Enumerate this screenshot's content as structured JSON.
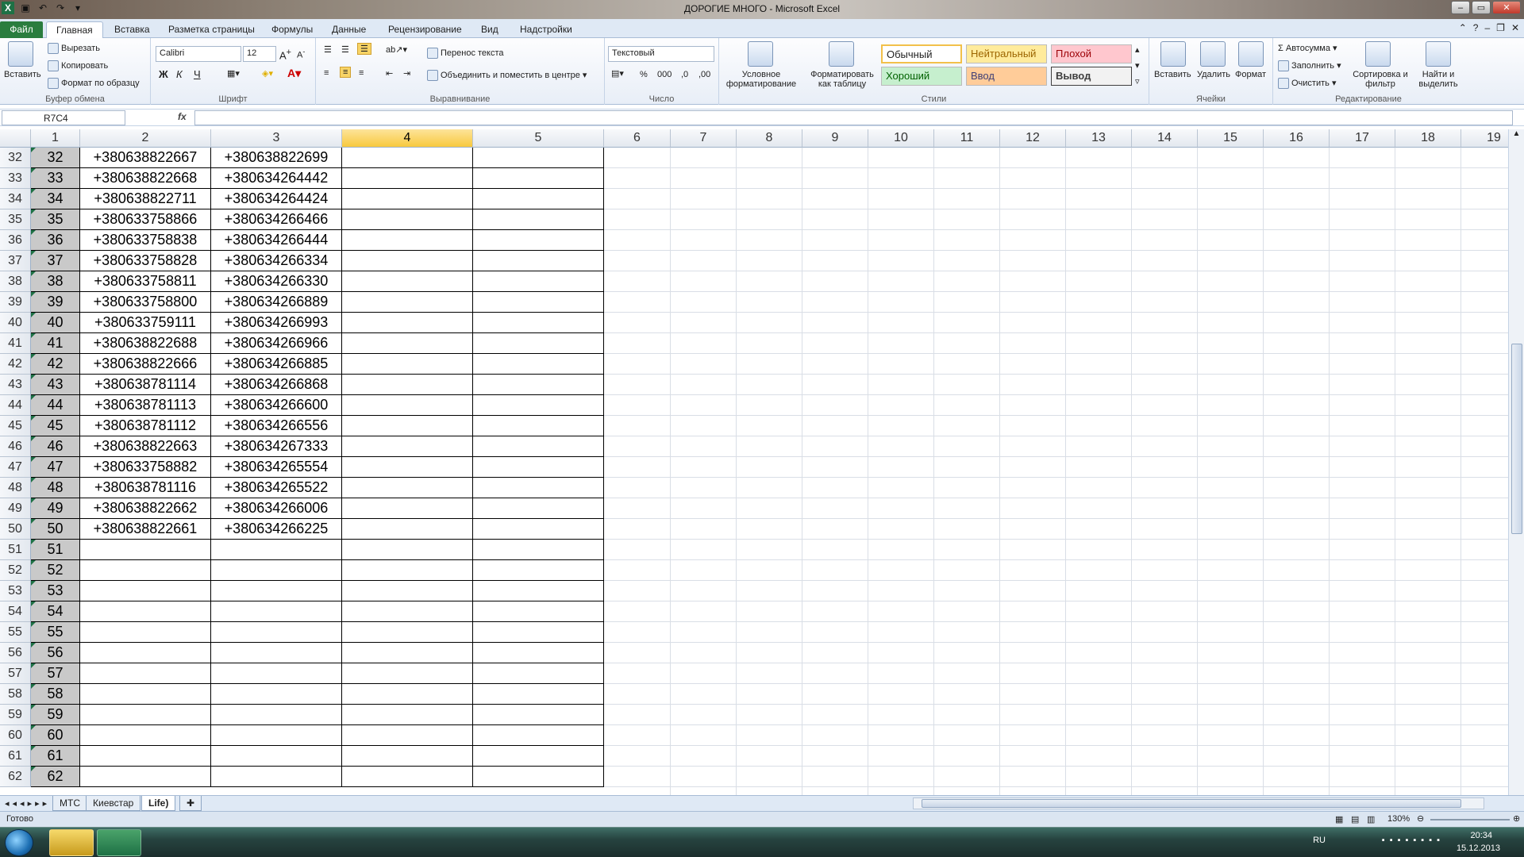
{
  "window": {
    "title": "ДОРОГИЕ МНОГО  -  Microsoft Excel"
  },
  "ribbon_tabs": [
    "Файл",
    "Главная",
    "Вставка",
    "Разметка страницы",
    "Формулы",
    "Данные",
    "Рецензирование",
    "Вид",
    "Надстройки"
  ],
  "clipboard": {
    "paste": "Вставить",
    "cut": "Вырезать",
    "copy": "Копировать",
    "format_painter": "Формат по образцу",
    "label": "Буфер обмена"
  },
  "font": {
    "name": "Calibri",
    "size": "12",
    "bold": "Ж",
    "italic": "К",
    "underline": "Ч",
    "label": "Шрифт"
  },
  "alignment": {
    "wrap": "Перенос текста",
    "merge": "Объединить и поместить в центре",
    "label": "Выравнивание"
  },
  "number": {
    "format": "Текстовый",
    "percent": "%",
    "thousands": "000",
    "label": "Число"
  },
  "styles": {
    "conditional": "Условное форматирование",
    "as_table": "Форматировать как таблицу",
    "normal": "Обычный",
    "neutral": "Нейтральный",
    "bad": "Плохой",
    "good": "Хороший",
    "input": "Ввод",
    "output": "Вывод",
    "label": "Стили"
  },
  "cells_group": {
    "insert": "Вставить",
    "delete": "Удалить",
    "format": "Формат",
    "label": "Ячейки"
  },
  "editing": {
    "autosum": "Автосумма",
    "fill": "Заполнить",
    "clear": "Очистить",
    "sort": "Сортировка и фильтр",
    "find": "Найти и выделить",
    "label": "Редактирование"
  },
  "formula_bar": {
    "name_box": "R7C4",
    "fx": "fx",
    "value": ""
  },
  "columns": [
    "1",
    "2",
    "3",
    "4",
    "5",
    "6",
    "7",
    "8",
    "9",
    "10",
    "11",
    "12",
    "13",
    "14",
    "15",
    "16",
    "17",
    "18",
    "19"
  ],
  "selected_column": "4",
  "rows": [
    {
      "n": "32",
      "a": "32",
      "b": "+380638822667",
      "c": "+380638822699"
    },
    {
      "n": "33",
      "a": "33",
      "b": "+380638822668",
      "c": "+380634264442"
    },
    {
      "n": "34",
      "a": "34",
      "b": "+380638822711",
      "c": "+380634264424"
    },
    {
      "n": "35",
      "a": "35",
      "b": "+380633758866",
      "c": "+380634266466"
    },
    {
      "n": "36",
      "a": "36",
      "b": "+380633758838",
      "c": "+380634266444"
    },
    {
      "n": "37",
      "a": "37",
      "b": "+380633758828",
      "c": "+380634266334"
    },
    {
      "n": "38",
      "a": "38",
      "b": "+380633758811",
      "c": "+380634266330"
    },
    {
      "n": "39",
      "a": "39",
      "b": "+380633758800",
      "c": "+380634266889"
    },
    {
      "n": "40",
      "a": "40",
      "b": "+380633759111",
      "c": "+380634266993"
    },
    {
      "n": "41",
      "a": "41",
      "b": "+380638822688",
      "c": "+380634266966"
    },
    {
      "n": "42",
      "a": "42",
      "b": "+380638822666",
      "c": "+380634266885"
    },
    {
      "n": "43",
      "a": "43",
      "b": "+380638781114",
      "c": "+380634266868"
    },
    {
      "n": "44",
      "a": "44",
      "b": "+380638781113",
      "c": "+380634266600"
    },
    {
      "n": "45",
      "a": "45",
      "b": "+380638781112",
      "c": "+380634266556"
    },
    {
      "n": "46",
      "a": "46",
      "b": "+380638822663",
      "c": "+380634267333"
    },
    {
      "n": "47",
      "a": "47",
      "b": "+380633758882",
      "c": "+380634265554"
    },
    {
      "n": "48",
      "a": "48",
      "b": "+380638781116",
      "c": "+380634265522"
    },
    {
      "n": "49",
      "a": "49",
      "b": "+380638822662",
      "c": "+380634266006"
    },
    {
      "n": "50",
      "a": "50",
      "b": "+380638822661",
      "c": "+380634266225"
    },
    {
      "n": "51",
      "a": "51",
      "b": "",
      "c": ""
    },
    {
      "n": "52",
      "a": "52",
      "b": "",
      "c": ""
    },
    {
      "n": "53",
      "a": "53",
      "b": "",
      "c": ""
    },
    {
      "n": "54",
      "a": "54",
      "b": "",
      "c": ""
    },
    {
      "n": "55",
      "a": "55",
      "b": "",
      "c": ""
    },
    {
      "n": "56",
      "a": "56",
      "b": "",
      "c": ""
    },
    {
      "n": "57",
      "a": "57",
      "b": "",
      "c": ""
    },
    {
      "n": "58",
      "a": "58",
      "b": "",
      "c": ""
    },
    {
      "n": "59",
      "a": "59",
      "b": "",
      "c": ""
    },
    {
      "n": "60",
      "a": "60",
      "b": "",
      "c": ""
    },
    {
      "n": "61",
      "a": "61",
      "b": "",
      "c": ""
    },
    {
      "n": "62",
      "a": "62",
      "b": "",
      "c": ""
    }
  ],
  "sheets": [
    "МТС",
    "Киевстар",
    "Life)"
  ],
  "active_sheet": "Life)",
  "status": {
    "ready": "Готово",
    "zoom": "130%"
  },
  "tray": {
    "lang": "RU",
    "time": "20:34",
    "date": "15.12.2013"
  },
  "colors": {
    "file_tab": "#2a7d3e",
    "selected_header": "#f8c93e",
    "excel_green": "#1e7145"
  }
}
